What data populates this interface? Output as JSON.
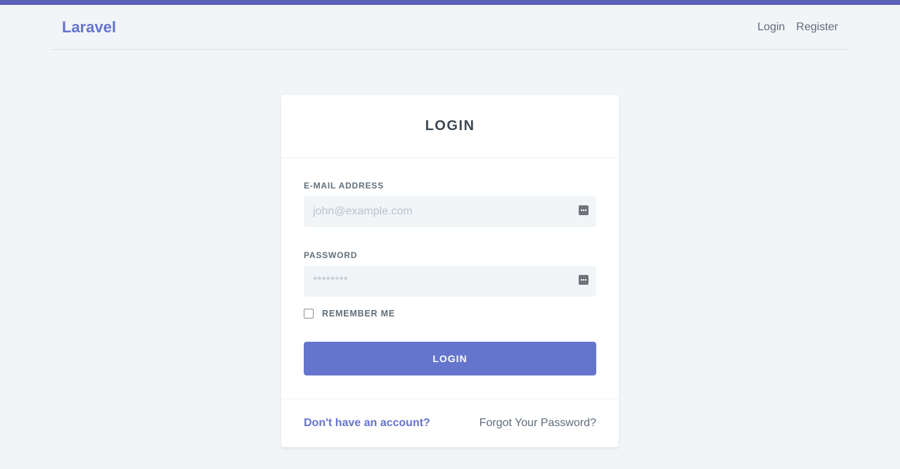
{
  "navbar": {
    "brand": "Laravel",
    "links": {
      "login": "Login",
      "register": "Register"
    }
  },
  "form": {
    "title": "LOGIN",
    "email": {
      "label": "E-MAIL ADDRESS",
      "placeholder": "john@example.com",
      "value": ""
    },
    "password": {
      "label": "PASSWORD",
      "placeholder": "********",
      "value": ""
    },
    "remember_label": "REMEMBER ME",
    "remember_checked": false,
    "submit_label": "LOGIN"
  },
  "footer": {
    "register_link": "Don't have an account?",
    "forgot_link": "Forgot Your Password?"
  },
  "colors": {
    "accent": "#6574cd",
    "topbar": "#5a5fb8",
    "background": "#f1f5f8"
  },
  "icons": {
    "field_icon": "password-manager-key-icon"
  }
}
